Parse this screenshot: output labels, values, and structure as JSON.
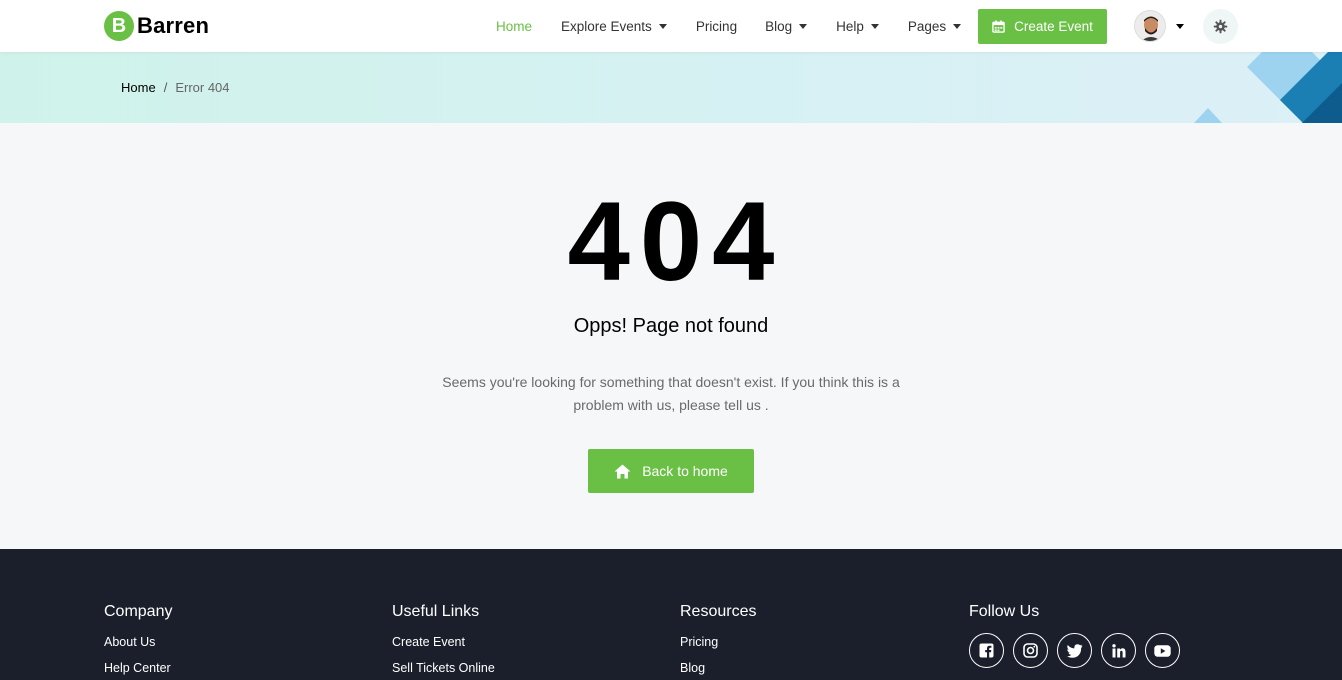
{
  "brand": {
    "logo_letter": "B",
    "name": "Barren",
    "accent_color": "#6ac045"
  },
  "nav": {
    "items": [
      {
        "label": "Home",
        "active": true,
        "dropdown": false
      },
      {
        "label": "Explore Events",
        "active": false,
        "dropdown": true
      },
      {
        "label": "Pricing",
        "active": false,
        "dropdown": false
      },
      {
        "label": "Blog",
        "active": false,
        "dropdown": true
      },
      {
        "label": "Help",
        "active": false,
        "dropdown": true
      },
      {
        "label": "Pages",
        "active": false,
        "dropdown": true
      }
    ],
    "create_event_label": "Create Event",
    "create_event_icon": "calendar-icon",
    "theme_icon": "gear-icon"
  },
  "breadcrumb": {
    "home": "Home",
    "separator": "/",
    "current": "Error 404"
  },
  "error": {
    "code": "404",
    "title": "Opps! Page not found",
    "description": "Seems you're looking for something that doesn't exist. If you think this is a problem with us, please tell us .",
    "button_label": "Back to home",
    "button_icon": "home-icon"
  },
  "footer": {
    "company": {
      "title": "Company",
      "links": [
        "About Us",
        "Help Center"
      ]
    },
    "useful_links": {
      "title": "Useful Links",
      "links": [
        "Create Event",
        "Sell Tickets Online"
      ]
    },
    "resources": {
      "title": "Resources",
      "links": [
        "Pricing",
        "Blog"
      ]
    },
    "follow": {
      "title": "Follow Us",
      "icons": [
        "facebook-icon",
        "instagram-icon",
        "twitter-icon",
        "linkedin-icon",
        "youtube-icon"
      ]
    }
  },
  "colors": {
    "footer_bg": "#1b1e2b",
    "page_bg": "#f5f7f9"
  }
}
